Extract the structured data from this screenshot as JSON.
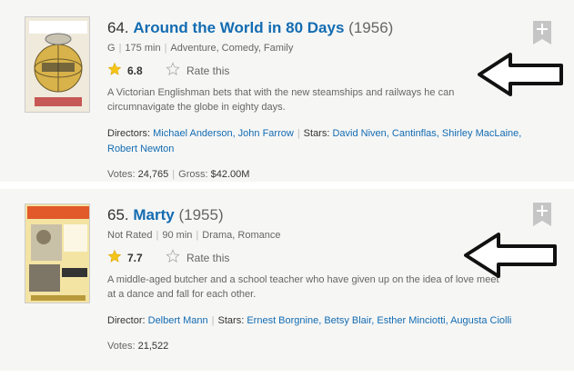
{
  "items": [
    {
      "index": "64.",
      "title": "Around the World in 80 Days",
      "year": "(1956)",
      "certificate": "G",
      "runtime": "175 min",
      "genres": "Adventure, Comedy, Family",
      "rating": "6.8",
      "rate_label": "Rate this",
      "description": "A Victorian Englishman bets that with the new steamships and railways he can circumnavigate the globe in eighty days.",
      "directors_label": "Directors:",
      "directors": "Michael Anderson, John Farrow",
      "stars_label": "Stars:",
      "stars": "David Niven, Cantinflas, Shirley MacLaine, Robert Newton",
      "votes_label": "Votes:",
      "votes": "24,765",
      "gross_label": "Gross:",
      "gross": "$42.00M"
    },
    {
      "index": "65.",
      "title": "Marty",
      "year": "(1955)",
      "certificate": "Not Rated",
      "runtime": "90 min",
      "genres": "Drama, Romance",
      "rating": "7.7",
      "rate_label": "Rate this",
      "description": "A middle-aged butcher and a school teacher who have given up on the idea of love meet at a dance and fall for each other.",
      "directors_label": "Director:",
      "directors": "Delbert Mann",
      "stars_label": "Stars:",
      "stars": "Ernest Borgnine, Betsy Blair, Esther Minciotti, Augusta Ciolli",
      "votes_label": "Votes:",
      "votes": "21,522"
    }
  ],
  "colors": {
    "link": "#136cb2",
    "star": "#f5c518",
    "background": "#f6f6f5"
  },
  "icons": {
    "rating": "star-icon",
    "rate": "star-outline-icon",
    "add": "plus-icon",
    "annotation": "arrow-left-icon"
  }
}
